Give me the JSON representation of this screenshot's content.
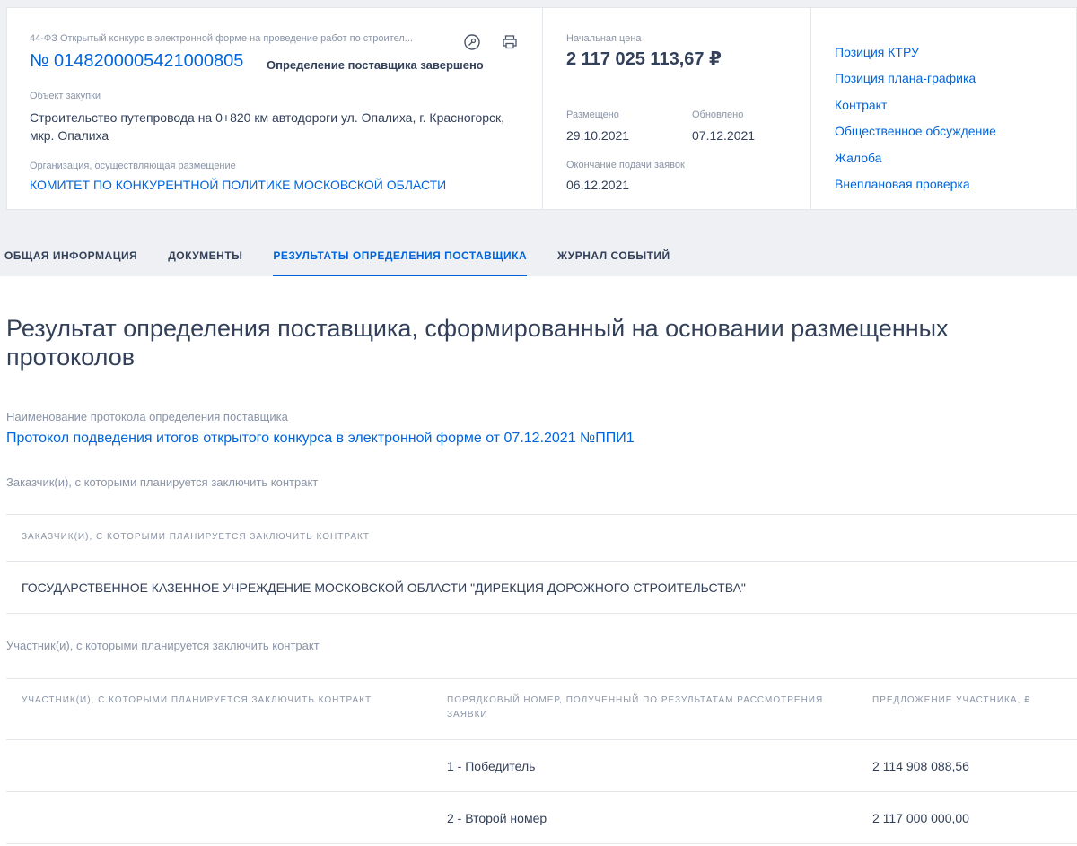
{
  "header": {
    "notice_type": "44-ФЗ Открытый конкурс в электронной форме на проведение работ по строител...",
    "notice_number": "№ 0148200005421000805",
    "status": "Определение поставщика завершено",
    "object_label": "Объект закупки",
    "object_text": "Строительство путепровода на 0+820 км автодороги ул. Опалиха, г. Красногорск, мкр. Опалиха",
    "org_label": "Организация, осуществляющая размещение",
    "org_name": "КОМИТЕТ ПО КОНКУРЕНТНОЙ ПОЛИТИКЕ МОСКОВСКОЙ ОБЛАСТИ",
    "price_label": "Начальная цена",
    "price_value": "2 117 025 113,67 ₽",
    "placed_label": "Размещено",
    "placed_value": "29.10.2021",
    "updated_label": "Обновлено",
    "updated_value": "07.12.2021",
    "end_label": "Окончание подачи заявок",
    "end_value": "06.12.2021",
    "links": [
      "Позиция КТРУ",
      "Позиция плана-графика",
      "Контракт",
      "Общественное обсуждение",
      "Жалоба",
      "Внеплановая проверка"
    ]
  },
  "tabs": [
    "ОБЩАЯ ИНФОРМАЦИЯ",
    "ДОКУМЕНТЫ",
    "РЕЗУЛЬТАТЫ ОПРЕДЕЛЕНИЯ ПОСТАВЩИКА",
    "ЖУРНАЛ СОБЫТИЙ"
  ],
  "main": {
    "title": "Результат определения поставщика, сформированный на основании размещенных протоколов",
    "protocol_label": "Наименование протокола определения поставщика",
    "protocol_link": "Протокол подведения итогов открытого конкурса в электронной форме от 07.12.2021 №ППИ1",
    "customers_label": "Заказчик(и), с которыми планируется заключить контракт",
    "customers_header": "Заказчик(и), с которыми планируется заключить контракт",
    "customers_row": "ГОСУДАРСТВЕННОЕ КАЗЕННОЕ УЧРЕЖДЕНИЕ МОСКОВСКОЙ ОБЛАСТИ \"ДИРЕКЦИЯ ДОРОЖНОГО СТРОИТЕЛЬСТВА\"",
    "participants_label": "Участник(и), с которыми планируется заключить контракт",
    "participants_headers": [
      "Участник(и), с которыми планируется заключить контракт",
      "Порядковый номер, полученный по результатам рассмотрения заявки",
      "Предложение участника, ₽"
    ],
    "participants_rows": [
      {
        "name": "",
        "rank": "1 - Победитель",
        "offer": "2 114 908 088,56"
      },
      {
        "name": "",
        "rank": "2 - Второй номер",
        "offer": "2 117 000 000,00"
      }
    ]
  },
  "colors": {
    "accent": "#0065dd",
    "text": "#334059",
    "muted": "#8a94a6",
    "band": "#eef0f3"
  }
}
